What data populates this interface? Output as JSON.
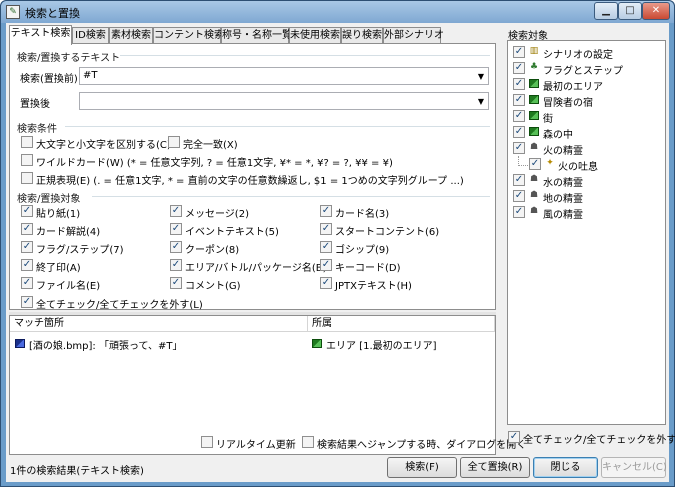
{
  "window": {
    "title": "検索と置換"
  },
  "tabs": [
    {
      "label": "テキスト検索"
    },
    {
      "label": "ID検索"
    },
    {
      "label": "素材検索"
    },
    {
      "label": "コンテント検索"
    },
    {
      "label": "称号・名称一覧"
    },
    {
      "label": "未使用検索"
    },
    {
      "label": "誤り検索"
    },
    {
      "label": "外部シナリオ"
    }
  ],
  "search_text_group": {
    "title": "検索/置換するテキスト",
    "search_label": "検索(置換前)",
    "search_value": "#T",
    "replace_label": "置換後",
    "replace_value": ""
  },
  "conditions_group": {
    "title": "検索条件",
    "case": "大文字と小文字を区別する(C)",
    "exact": "完全一致(X)",
    "wildcard": "ワイルドカード(W) (* = 任意文字列, ? = 任意1文字, ¥* = *, ¥? = ?, ¥¥ = ¥)",
    "regex": "正規表現(E) (. = 任意1文字, * = 直前の文字の任意数繰返し, $1 = 1つめの文字列グループ ...)"
  },
  "targets_group": {
    "title": "検索/置換対象",
    "items": [
      {
        "label": "貼り紙(1)"
      },
      {
        "label": "メッセージ(2)"
      },
      {
        "label": "カード名(3)"
      },
      {
        "label": "カード解説(4)"
      },
      {
        "label": "イベントテキスト(5)"
      },
      {
        "label": "スタートコンテント(6)"
      },
      {
        "label": "フラグ/ステップ(7)"
      },
      {
        "label": "クーポン(8)"
      },
      {
        "label": "ゴシップ(9)"
      },
      {
        "label": "終了印(A)"
      },
      {
        "label": "エリア/バトル/パッケージ名(B)"
      },
      {
        "label": "キーコード(D)"
      },
      {
        "label": "ファイル名(E)"
      },
      {
        "label": "コメント(G)"
      },
      {
        "label": "JPTXテキスト(H)"
      }
    ],
    "check_all": "全てチェック/全てチェックを外す(L)"
  },
  "results": {
    "col_match": "マッチ箇所",
    "col_owner": "所属",
    "rows": [
      {
        "match": "[酒の娘.bmp]: 「頑張って、#T」",
        "owner": "エリア [1.最初のエリア]"
      }
    ]
  },
  "options": {
    "realtime": "リアルタイム更新",
    "open_on_jump": "検索結果へジャンプする時、ダイアログを開く"
  },
  "search_targets": {
    "title": "検索対象",
    "nodes": [
      {
        "label": "シナリオの設定"
      },
      {
        "label": "フラグとステップ"
      },
      {
        "label": "最初のエリア"
      },
      {
        "label": "冒険者の宿"
      },
      {
        "label": "街"
      },
      {
        "label": "森の中"
      },
      {
        "label": "火の精霊"
      },
      {
        "label": "火の吐息"
      },
      {
        "label": "水の精霊"
      },
      {
        "label": "地の精霊"
      },
      {
        "label": "風の精霊"
      }
    ],
    "check_all": "全てチェック/全てチェックを外す"
  },
  "status_text": "1件の検索結果(テキスト検索)",
  "buttons": {
    "search": "検索(F)",
    "replace_all": "全て置換(R)",
    "close": "閉じる",
    "cancel": "キャンセル(C)"
  }
}
